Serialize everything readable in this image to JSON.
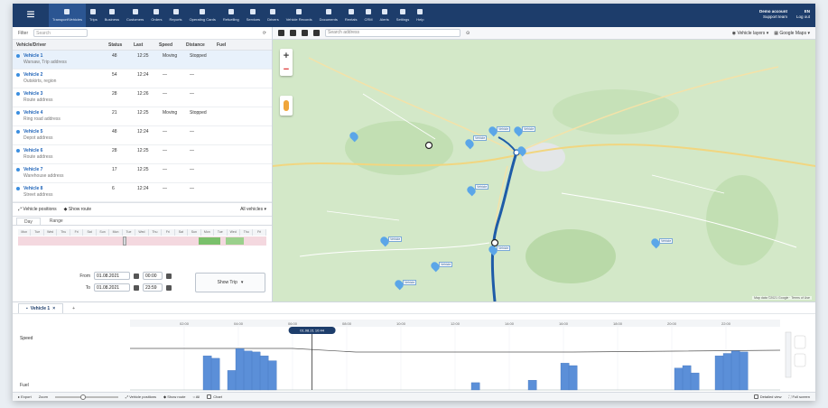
{
  "topnav": {
    "items": [
      {
        "label": "Transport/Vehicles",
        "active": true
      },
      {
        "label": "Trips"
      },
      {
        "label": "Business"
      },
      {
        "label": "Customers"
      },
      {
        "label": "Orders"
      },
      {
        "label": "Reports"
      },
      {
        "label": "Operating Cards"
      },
      {
        "label": "Refuelling"
      },
      {
        "label": "Services"
      },
      {
        "label": "Drivers"
      },
      {
        "label": "Vehicle Records"
      },
      {
        "label": "Documents"
      },
      {
        "label": "Rentals"
      },
      {
        "label": "CRM"
      },
      {
        "label": "Alerts"
      },
      {
        "label": "Settings"
      },
      {
        "label": "Help"
      }
    ],
    "user_line1": "Demo account",
    "user_line2": "Support team",
    "lang": "EN",
    "logout": "Log out"
  },
  "leftpanel": {
    "filter_label": "Filter",
    "search_placeholder": "Search",
    "columns": [
      "Vehicle/Driver",
      "Status",
      "Last",
      "Speed",
      "Distance",
      "Fuel"
    ],
    "vehicles": [
      {
        "name": "Vehicle 1",
        "status": "48",
        "last": "12:25",
        "speed": "Moving",
        "dist": "Stopped",
        "addr": "Warsaw, Trip address",
        "selected": true
      },
      {
        "name": "Vehicle 2",
        "status": "54",
        "last": "12:24",
        "speed": "—",
        "dist": "—",
        "addr": "Outskirts, region"
      },
      {
        "name": "Vehicle 3",
        "status": "28",
        "last": "12:26",
        "speed": "—",
        "dist": "—",
        "addr": "Route address"
      },
      {
        "name": "Vehicle 4",
        "status": "21",
        "last": "12:25",
        "speed": "Moving",
        "dist": "Stopped",
        "addr": "Ring road address"
      },
      {
        "name": "Vehicle 5",
        "status": "48",
        "last": "12:24",
        "speed": "—",
        "dist": "—",
        "addr": "Depot address"
      },
      {
        "name": "Vehicle 6",
        "status": "28",
        "last": "12:25",
        "speed": "—",
        "dist": "—",
        "addr": "Route address"
      },
      {
        "name": "Vehicle 7",
        "status": "17",
        "last": "12:25",
        "speed": "—",
        "dist": "—",
        "addr": "Warehouse address"
      },
      {
        "name": "Vehicle 8",
        "status": "6",
        "last": "12:24",
        "speed": "—",
        "dist": "—",
        "addr": "Street address"
      }
    ],
    "actions": {
      "track": "Vehicle positions",
      "show_route": "Show route",
      "all_vehicles": "All vehicles"
    },
    "tabs": [
      "Day",
      "Range"
    ],
    "days": [
      "Mon",
      "Tue",
      "Wed",
      "Thu",
      "Fri",
      "Sat",
      "Sun",
      "Mon",
      "Tue",
      "Wed",
      "Thu",
      "Fri",
      "Sat",
      "Sun",
      "Mon",
      "Tue",
      "Wed",
      "Thu",
      "Fri"
    ],
    "from_label": "From",
    "to_label": "To",
    "from_date": "01.08.2021",
    "from_time": "00:00",
    "to_date": "01.08.2021",
    "to_time": "23:59",
    "show_button": "Show Trip"
  },
  "map": {
    "address_placeholder": "Search address",
    "layers_label": "Vehicle layers",
    "maptype_label": "Google Maps",
    "credit": "Map data ©2021 Google · Terms of Use",
    "pins": [
      "Vehicle",
      "Vehicle",
      "Vehicle",
      "Vehicle",
      "Vehicle",
      "Vehicle",
      "Vehicle",
      "Vehicle",
      "Vehicle"
    ]
  },
  "chart": {
    "tab_label": "Vehicle 1",
    "ylabels": [
      "Speed",
      "Fuel"
    ],
    "cursor_label": "01.08.21 10:44",
    "time_labels": [
      "02:00",
      "04:00",
      "06:00",
      "08:00",
      "10:00",
      "12:00",
      "14:00",
      "16:00",
      "18:00",
      "20:00",
      "22:00"
    ]
  },
  "chart_data": {
    "type": "area",
    "series": [
      {
        "values": [
          0,
          0,
          0,
          0,
          0,
          0,
          0,
          0,
          0,
          70,
          65,
          0,
          40,
          85,
          80,
          78,
          70,
          60,
          0,
          0,
          0,
          0,
          0,
          0,
          0,
          0,
          0,
          0,
          0,
          0,
          0,
          0,
          0,
          0,
          0,
          0,
          0,
          0,
          0,
          0,
          0,
          0,
          15,
          0,
          0,
          0,
          0,
          0,
          0,
          20,
          0,
          0,
          0,
          55,
          50,
          0,
          0,
          0,
          0,
          0,
          0,
          0,
          0,
          0,
          0,
          0,
          0,
          45,
          50,
          35,
          0,
          0,
          70,
          75,
          80,
          78,
          0,
          0,
          0,
          0
        ]
      }
    ]
  },
  "bottombar": {
    "export": "Export",
    "zoom": "Zoom",
    "positions": "Vehicle positions",
    "show_route": "Show route",
    "all": "All",
    "chart_toggle": "Chart",
    "right1": "Detailed view",
    "right2": "Full screen"
  }
}
